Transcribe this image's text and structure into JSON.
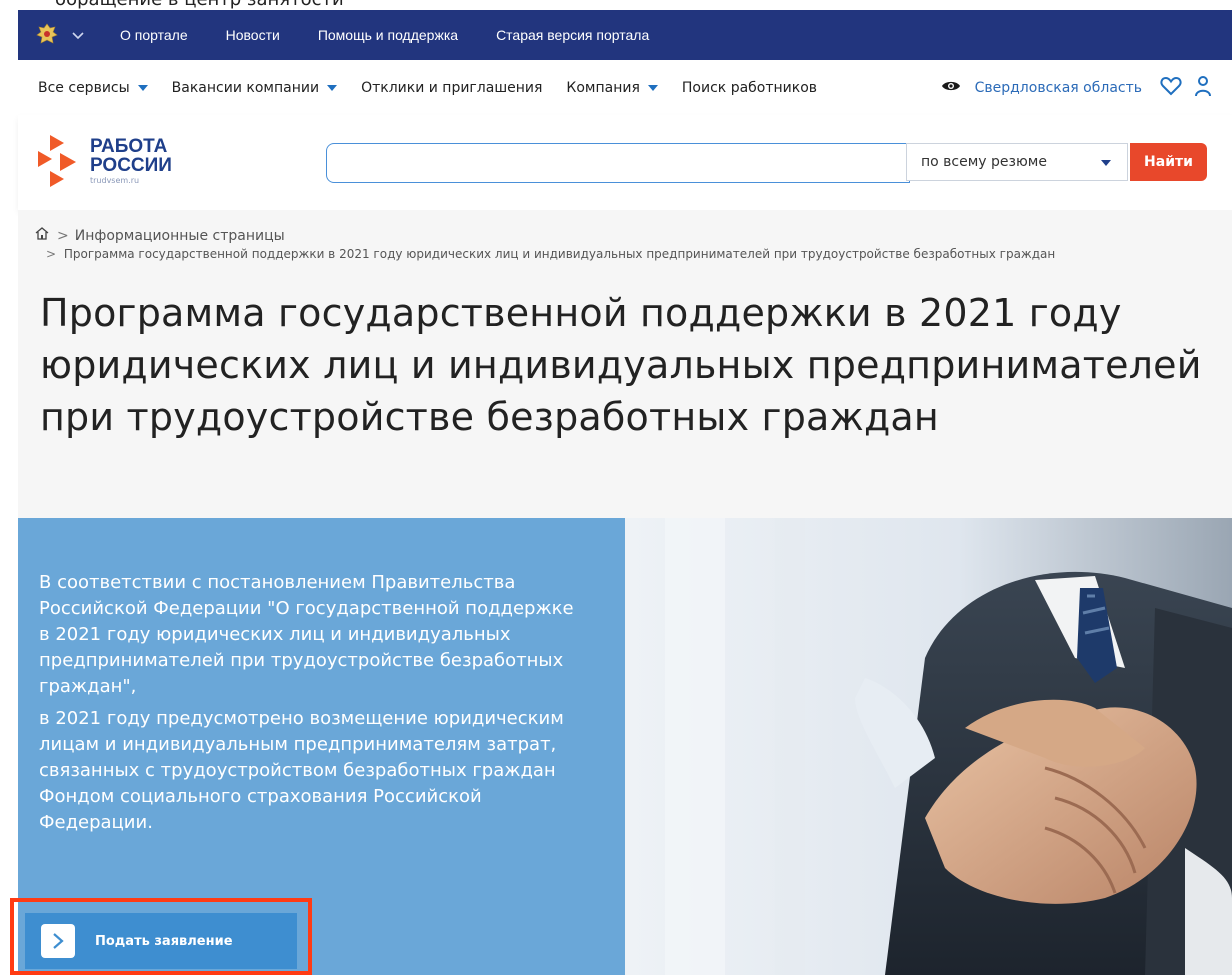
{
  "top_strip": {
    "cut_text": "обращение в центр занятости"
  },
  "gov_bar": {
    "links": [
      "О портале",
      "Новости",
      "Помощь и поддержка",
      "Старая версия портала"
    ]
  },
  "menu": {
    "items": [
      "Все сервисы",
      "Вакансии компании",
      "Отклики и приглашения",
      "Компания",
      "Поиск работников"
    ],
    "region": "Свердловская область"
  },
  "logo": {
    "line1": "РАБОТА",
    "line2": "РОССИИ",
    "domain": "trudvsem.ru"
  },
  "search": {
    "value": "",
    "scope": "по всему резюме",
    "button": "Найти"
  },
  "breadcrumb": {
    "level1": "Информационные страницы",
    "level2": "Программа государственной поддержки в 2021 году юридических лиц и индивидуальных предпринимателей при трудоустройстве безработных граждан"
  },
  "page": {
    "title": "Программа государственной поддержки в 2021 году юридических лиц и индивидуальных предпринимателей при трудоустройстве безработных граждан"
  },
  "hero": {
    "paragraph1": "В соответствии с постановлением Правительства Российской Федерации \"О государственной поддержке в 2021 году юридических лиц и индивидуальных предпринимателей при трудоустройстве безработных граждан\",",
    "paragraph2": "в 2021 году предусмотрено возмещение юридическим лицам и индивидуальным предпринимателям затрат, связанных с трудоустройством безработных граждан Фондом социального страхования Российской Федерации.",
    "apply_button": "Подать заявление"
  },
  "colors": {
    "gov_bar": "#22357e",
    "accent_blue": "#1f6fbf",
    "hero_blue": "#6aa7d8",
    "find_button": "#e8482b",
    "highlight": "#ff3b14"
  },
  "icons": [
    "emblem-icon",
    "chevron-down-icon",
    "eye-icon",
    "heart-icon",
    "user-icon",
    "home-icon",
    "arrow-right-icon"
  ]
}
